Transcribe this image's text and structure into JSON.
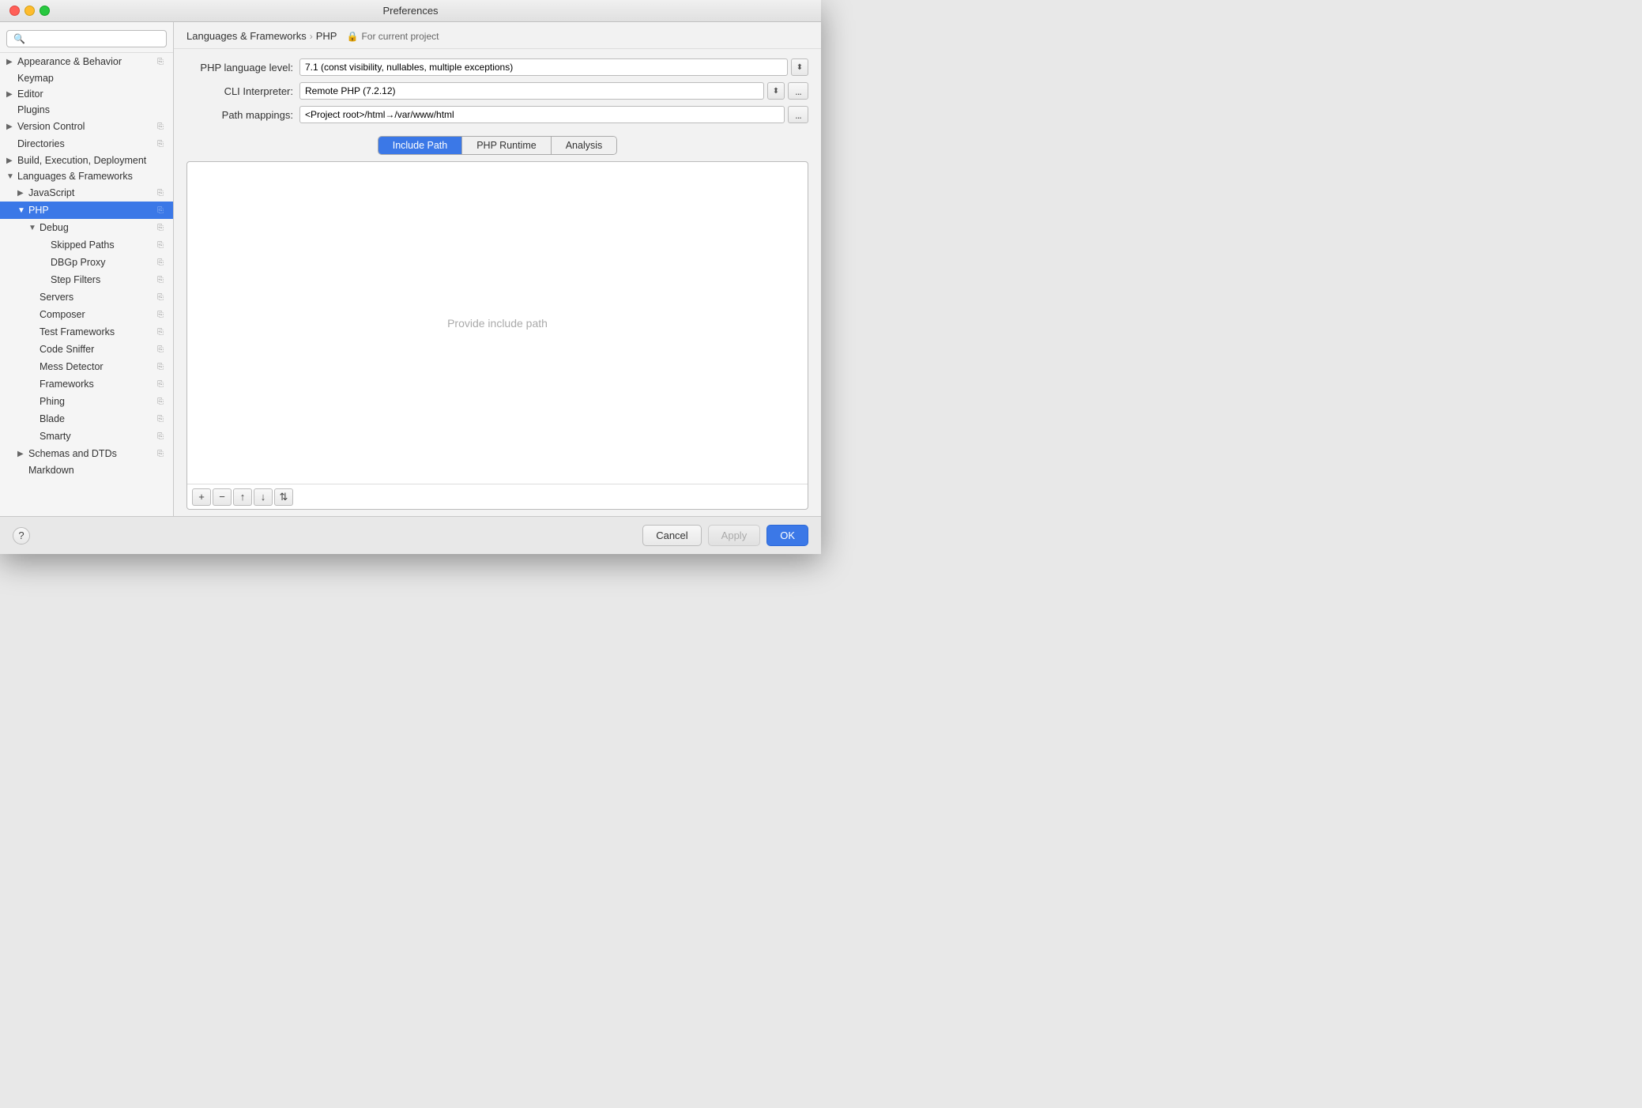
{
  "titleBar": {
    "title": "Preferences"
  },
  "search": {
    "placeholder": "🔍"
  },
  "sidebar": {
    "items": [
      {
        "id": "appearance",
        "label": "Appearance & Behavior",
        "indent": 0,
        "arrow": "▶",
        "hasIcon": true
      },
      {
        "id": "keymap",
        "label": "Keymap",
        "indent": 0,
        "arrow": "",
        "hasIcon": false
      },
      {
        "id": "editor",
        "label": "Editor",
        "indent": 0,
        "arrow": "▶",
        "hasIcon": false
      },
      {
        "id": "plugins",
        "label": "Plugins",
        "indent": 0,
        "arrow": "",
        "hasIcon": false
      },
      {
        "id": "version-control",
        "label": "Version Control",
        "indent": 0,
        "arrow": "▶",
        "hasIcon": true
      },
      {
        "id": "directories",
        "label": "Directories",
        "indent": 0,
        "arrow": "",
        "hasIcon": true
      },
      {
        "id": "build",
        "label": "Build, Execution, Deployment",
        "indent": 0,
        "arrow": "▶",
        "hasIcon": false
      },
      {
        "id": "lang-frameworks",
        "label": "Languages & Frameworks",
        "indent": 0,
        "arrow": "▼",
        "hasIcon": false
      },
      {
        "id": "javascript",
        "label": "JavaScript",
        "indent": 1,
        "arrow": "▶",
        "hasIcon": true
      },
      {
        "id": "php",
        "label": "PHP",
        "indent": 1,
        "arrow": "▼",
        "hasIcon": true,
        "selected": true
      },
      {
        "id": "debug",
        "label": "Debug",
        "indent": 2,
        "arrow": "▼",
        "hasIcon": true
      },
      {
        "id": "skipped-paths",
        "label": "Skipped Paths",
        "indent": 3,
        "arrow": "",
        "hasIcon": true
      },
      {
        "id": "dbgp-proxy",
        "label": "DBGp Proxy",
        "indent": 3,
        "arrow": "",
        "hasIcon": true
      },
      {
        "id": "step-filters",
        "label": "Step Filters",
        "indent": 3,
        "arrow": "",
        "hasIcon": true
      },
      {
        "id": "servers",
        "label": "Servers",
        "indent": 2,
        "arrow": "",
        "hasIcon": true
      },
      {
        "id": "composer",
        "label": "Composer",
        "indent": 2,
        "arrow": "",
        "hasIcon": true
      },
      {
        "id": "test-frameworks",
        "label": "Test Frameworks",
        "indent": 2,
        "arrow": "",
        "hasIcon": true
      },
      {
        "id": "code-sniffer",
        "label": "Code Sniffer",
        "indent": 2,
        "arrow": "",
        "hasIcon": true
      },
      {
        "id": "mess-detector",
        "label": "Mess Detector",
        "indent": 2,
        "arrow": "",
        "hasIcon": true
      },
      {
        "id": "frameworks",
        "label": "Frameworks",
        "indent": 2,
        "arrow": "",
        "hasIcon": true
      },
      {
        "id": "phing",
        "label": "Phing",
        "indent": 2,
        "arrow": "",
        "hasIcon": true
      },
      {
        "id": "blade",
        "label": "Blade",
        "indent": 2,
        "arrow": "",
        "hasIcon": true
      },
      {
        "id": "smarty",
        "label": "Smarty",
        "indent": 2,
        "arrow": "",
        "hasIcon": true
      },
      {
        "id": "schemas-dtds",
        "label": "Schemas and DTDs",
        "indent": 1,
        "arrow": "▶",
        "hasIcon": true
      },
      {
        "id": "markdown",
        "label": "Markdown",
        "indent": 1,
        "arrow": "",
        "hasIcon": false
      }
    ]
  },
  "breadcrumb": {
    "part1": "Languages & Frameworks",
    "arrow": "›",
    "part2": "PHP",
    "project": "For current project"
  },
  "form": {
    "phpLevelLabel": "PHP language level:",
    "phpLevelValue": "7.1 (const visibility, nullables, multiple exceptions)",
    "cliLabel": "CLI Interpreter:",
    "cliValue": "Remote PHP (7.2.12)",
    "pathMappingsLabel": "Path mappings:",
    "pathMappingsValue": "<Project root>/html→/var/www/html"
  },
  "tabs": [
    {
      "id": "include-path",
      "label": "Include Path",
      "active": true
    },
    {
      "id": "php-runtime",
      "label": "PHP Runtime",
      "active": false
    },
    {
      "id": "analysis",
      "label": "Analysis",
      "active": false
    }
  ],
  "includePath": {
    "placeholder": "Provide include path"
  },
  "toolbar": {
    "addLabel": "+",
    "removeLabel": "−",
    "moveUpLabel": "↑",
    "moveDownLabel": "↓",
    "sortLabel": "⇅"
  },
  "footer": {
    "cancelLabel": "Cancel",
    "applyLabel": "Apply",
    "okLabel": "OK"
  },
  "helpIcon": "?"
}
